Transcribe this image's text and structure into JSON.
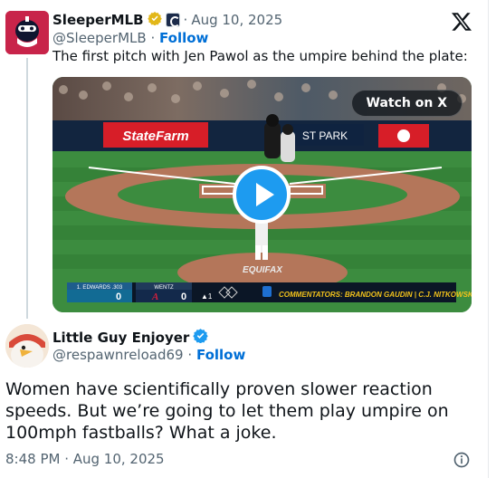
{
  "quoted": {
    "display_name": "SleeperMLB",
    "handle": "@SleeperMLB",
    "separator": "·",
    "date": "Aug 10, 2025",
    "follow_label": "Follow",
    "text": "The first pitch with Jen Pawol as the umpire behind the plate:",
    "media": {
      "watch_label": "Watch on X",
      "ad_left": "StateFarm",
      "ad_right": "ST PARK",
      "equifax": "EQUIFAX",
      "scorebug": {
        "left_batter": "1. EDWARDS .303",
        "left_score": "0",
        "right_pitcher": "WENTZ",
        "right_score": "0",
        "inning": "▲1",
        "commentators": "COMMENTATORS: BRANDON GAUDIN | C.J. NITKOWSKI"
      }
    }
  },
  "reply": {
    "display_name": "Little Guy Enjoyer",
    "handle": "@respawnreload69",
    "separator": "·",
    "follow_label": "Follow",
    "text": "Women have scientifically proven slower reaction speeds. But we’re going to let them play umpire on 100mph fastballs? What a joke.",
    "time": "8:48 PM · Aug 10, 2025"
  },
  "colors": {
    "follow": "#006fd6",
    "muted": "#536471",
    "play_button": "#1d9bf0",
    "verified_gold": "#e2b719",
    "verified_blue": "#1d9bf0"
  },
  "icons": [
    "x-logo-icon",
    "gold-verified-icon",
    "team-badge-icon",
    "blue-verified-icon",
    "play-icon",
    "info-icon"
  ]
}
